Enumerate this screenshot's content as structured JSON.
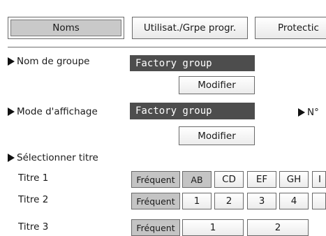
{
  "tabs": [
    {
      "label": "Noms",
      "active": true
    },
    {
      "label": "Utilisat./Grpe progr.",
      "active": false
    },
    {
      "label": "Protectic",
      "active": false
    }
  ],
  "group_name": {
    "label": "Nom de groupe",
    "value": "Factory group",
    "button": "Modifier"
  },
  "display_mode": {
    "label": "Mode d'affichage",
    "value": "Factory group",
    "button": "Modifier",
    "side_label": "N°"
  },
  "select_title": {
    "label": "Sélectionner titre",
    "rows": [
      {
        "label": "Titre 1",
        "options": [
          "Fréquent",
          "AB",
          "CD",
          "EF",
          "GH",
          "I"
        ]
      },
      {
        "label": "Titre 2",
        "options": [
          "Fréquent",
          "1",
          "2",
          "3",
          "4",
          ""
        ]
      },
      {
        "label": "Titre 3",
        "options": [
          "Fréquent",
          "1",
          "2"
        ]
      }
    ]
  },
  "colors": {
    "dark_field": "#4d4d4d",
    "selected_button": "#c4c4c4",
    "active_tab": "#c9c9c9"
  }
}
